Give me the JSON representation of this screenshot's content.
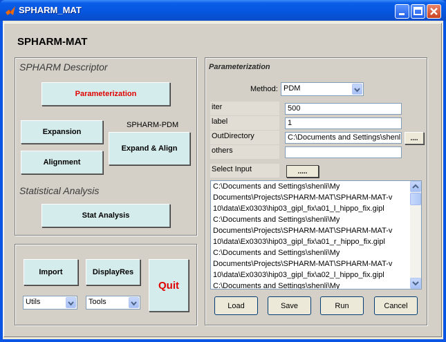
{
  "window": {
    "title": "SPHARM_MAT"
  },
  "app": {
    "heading": "SPHARM-MAT"
  },
  "descriptor": {
    "title": "SPHARM Descriptor",
    "parameterization_label": "Parameterization",
    "expansion_label": "Expansion",
    "alignment_label": "Alignment",
    "pdm_caption": "SPHARM-PDM",
    "expand_align_label": "Expand & Align"
  },
  "stats": {
    "title": "Statistical Analysis",
    "stat_label": "Stat Analysis"
  },
  "bottom": {
    "import_label": "Import",
    "displayres_label": "DisplayRes",
    "quit_label": "Quit",
    "utils_value": "Utils",
    "tools_value": "Tools"
  },
  "params": {
    "title": "Parameterization",
    "method_label": "Method:",
    "method_value": "PDM",
    "iter_label": "iter",
    "iter_value": "500",
    "label_label": "label",
    "label_value": "1",
    "outdir_label": "OutDirectory",
    "outdir_value": "C:\\Documents and Settings\\shenli\\My",
    "others_label": "others",
    "others_value": "",
    "browse_label": "....",
    "select_input_label": "Select Input",
    "select_input_btn": ".....",
    "files": [
      "C:\\Documents and Settings\\shenli\\My",
      "Documents\\Projects\\SPHARM-MAT\\SPHARM-MAT-v",
      "10\\data\\Ex0303\\hip03_gipl_fix\\a01_l_hippo_fix.gipl",
      "C:\\Documents and Settings\\shenli\\My",
      "Documents\\Projects\\SPHARM-MAT\\SPHARM-MAT-v",
      "10\\data\\Ex0303\\hip03_gipl_fix\\a01_r_hippo_fix.gipl",
      "C:\\Documents and Settings\\shenli\\My",
      "Documents\\Projects\\SPHARM-MAT\\SPHARM-MAT-v",
      "10\\data\\Ex0303\\hip03_gipl_fix\\a02_l_hippo_fix.gipl",
      "C:\\Documents and Settings\\shenli\\My"
    ],
    "load_label": "Load",
    "save_label": "Save",
    "run_label": "Run",
    "cancel_label": "Cancel"
  }
}
